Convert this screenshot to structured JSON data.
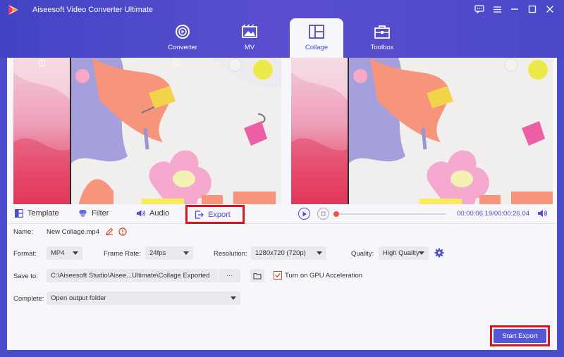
{
  "app": {
    "title": "Aiseesoft Video Converter Ultimate"
  },
  "tabs": [
    {
      "label": "Converter",
      "icon": "converter-icon"
    },
    {
      "label": "MV",
      "icon": "mv-icon"
    },
    {
      "label": "Collage",
      "icon": "collage-icon",
      "active": true
    },
    {
      "label": "Toolbox",
      "icon": "toolbox-icon"
    }
  ],
  "toolbar": {
    "template": "Template",
    "filter": "Filter",
    "audio": "Audio",
    "export": "Export"
  },
  "player": {
    "time": "00:00:06.19/00:00:26.04",
    "progress": 0.0
  },
  "settings": {
    "name_label": "Name:",
    "name_value": "New Collage.mp4",
    "format_label": "Format:",
    "format_value": "MP4",
    "frame_rate_label": "Frame Rate:",
    "frame_rate_value": "24fps",
    "resolution_label": "Resolution:",
    "resolution_value": "1280x720 (720p)",
    "quality_label": "Quality:",
    "quality_value": "High Quality",
    "save_to_label": "Save to:",
    "save_to_value": "C:\\Aiseesoft Studio\\Aisee...Ultimate\\Collage Exported",
    "browse_label": "···",
    "gpu_label": "Turn on GPU Acceleration",
    "gpu_checked": true,
    "complete_label": "Complete:",
    "complete_value": "Open output folder"
  },
  "actions": {
    "start_export": "Start Export"
  },
  "colors": {
    "accent": "#4c4ec7",
    "highlight": "#d8171c",
    "progress": "#f25544"
  }
}
